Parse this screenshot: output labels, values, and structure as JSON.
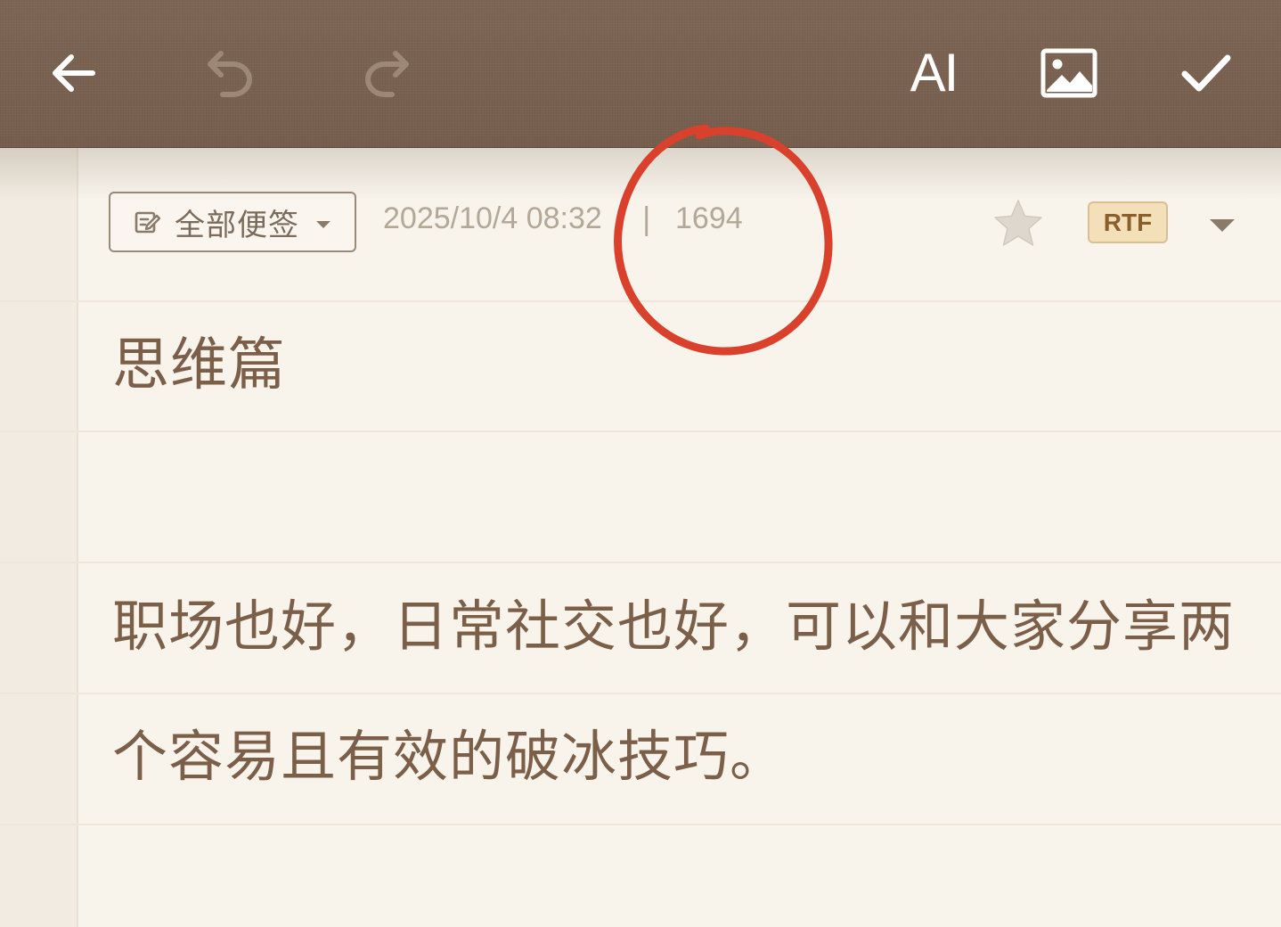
{
  "toolbar": {
    "back_icon": "arrow-left-icon",
    "undo_icon": "undo-icon",
    "redo_icon": "redo-icon",
    "ai_label": "AI",
    "image_icon": "image-icon",
    "confirm_icon": "check-icon"
  },
  "meta": {
    "folder": "全部便签",
    "date": "2025/10/4 08:32",
    "separator": "|",
    "char_count": "1694",
    "starred": false,
    "format_badge": "RTF"
  },
  "note": {
    "title": "思维篇",
    "lines": [
      "职场也好，日常社交也好，可以和大家分享两",
      "个容易且有效的破冰技巧。"
    ]
  },
  "colors": {
    "toolbar_bg": "#7a6251",
    "paper_bg": "#f8f4ec",
    "text": "#7b5f48",
    "meta_text": "#b3a797",
    "badge_bg": "#f3dfb8",
    "annotation": "#d9412c"
  }
}
